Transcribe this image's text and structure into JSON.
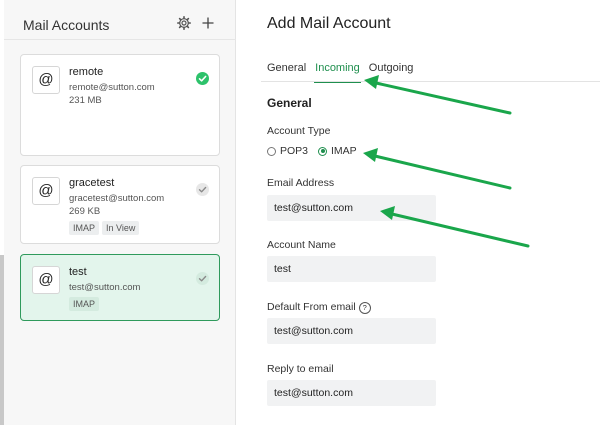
{
  "sidebar": {
    "title": "Mail Accounts",
    "accounts": [
      {
        "name": "remote",
        "email": "remote@sutton.com",
        "size": "231 MB",
        "tags": [],
        "status": "synced"
      },
      {
        "name": "gracetest",
        "email": "gracetest@sutton.com",
        "size": "269 KB",
        "tags": [
          "IMAP",
          "In View"
        ],
        "status": "default"
      },
      {
        "name": "test",
        "email": "test@sutton.com",
        "tags": [
          "IMAP"
        ],
        "status": "default",
        "selected": true
      }
    ]
  },
  "main": {
    "title": "Add Mail Account",
    "tabs": [
      {
        "label": "General"
      },
      {
        "label": "Incoming",
        "active": true
      },
      {
        "label": "Outgoing"
      }
    ],
    "section_title": "General",
    "account_type": {
      "label": "Account Type",
      "options": [
        "POP3",
        "IMAP"
      ],
      "selected": "IMAP"
    },
    "email_address": {
      "label": "Email Address",
      "value": "test@sutton.com"
    },
    "account_name": {
      "label": "Account Name",
      "value": "test"
    },
    "default_from": {
      "label": "Default From email",
      "value": "test@sutton.com"
    },
    "reply_to": {
      "label": "Reply to email",
      "value": "test@sutton.com"
    }
  },
  "icons": {
    "settings": "gear-icon",
    "add": "plus-icon",
    "account": "at-sign-icon",
    "status": "check-icon",
    "help": "question-circle-icon"
  },
  "colors": {
    "accent": "#1f8f4e",
    "success": "#2dc26b",
    "selected_card_bg": "#e3f5ec",
    "annotation_arrow": "#1aa64b"
  }
}
